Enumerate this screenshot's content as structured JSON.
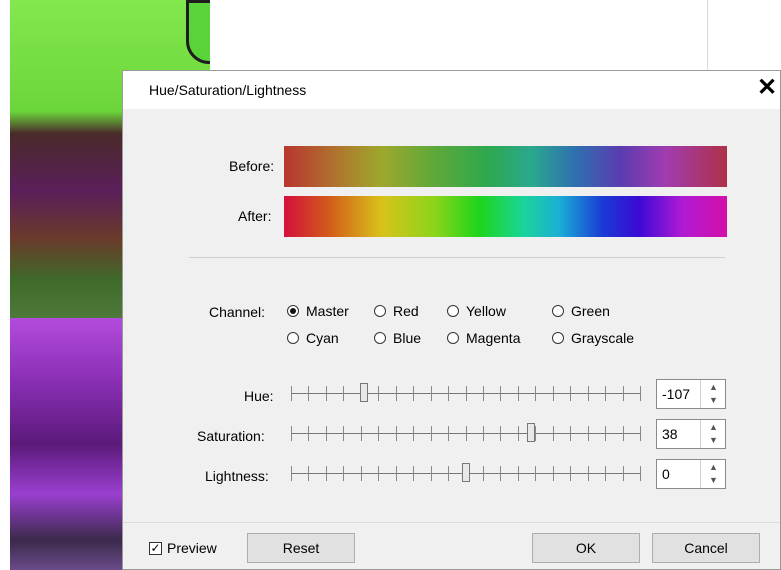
{
  "dialog": {
    "title": "Hue/Saturation/Lightness",
    "close_icon": "close-icon",
    "before_label": "Before:",
    "after_label": "After:",
    "channel_label": "Channel:",
    "channels": [
      {
        "label": "Master",
        "checked": true
      },
      {
        "label": "Red",
        "checked": false
      },
      {
        "label": "Yellow",
        "checked": false
      },
      {
        "label": "Green",
        "checked": false
      },
      {
        "label": "Cyan",
        "checked": false
      },
      {
        "label": "Blue",
        "checked": false
      },
      {
        "label": "Magenta",
        "checked": false
      },
      {
        "label": "Grayscale",
        "checked": false
      }
    ],
    "sliders": [
      {
        "label": "Hue:",
        "value": "-107",
        "min": -180,
        "max": 180
      },
      {
        "label": "Saturation:",
        "value": "38",
        "min": -100,
        "max": 100
      },
      {
        "label": "Lightness:",
        "value": "0",
        "min": -100,
        "max": 100
      }
    ],
    "preview_label": "Preview",
    "preview_checked": true,
    "reset_label": "Reset",
    "ok_label": "OK",
    "cancel_label": "Cancel"
  },
  "colors": {
    "dialog_bg": "#f0f0f0",
    "titlebar_bg": "#ffffff"
  }
}
